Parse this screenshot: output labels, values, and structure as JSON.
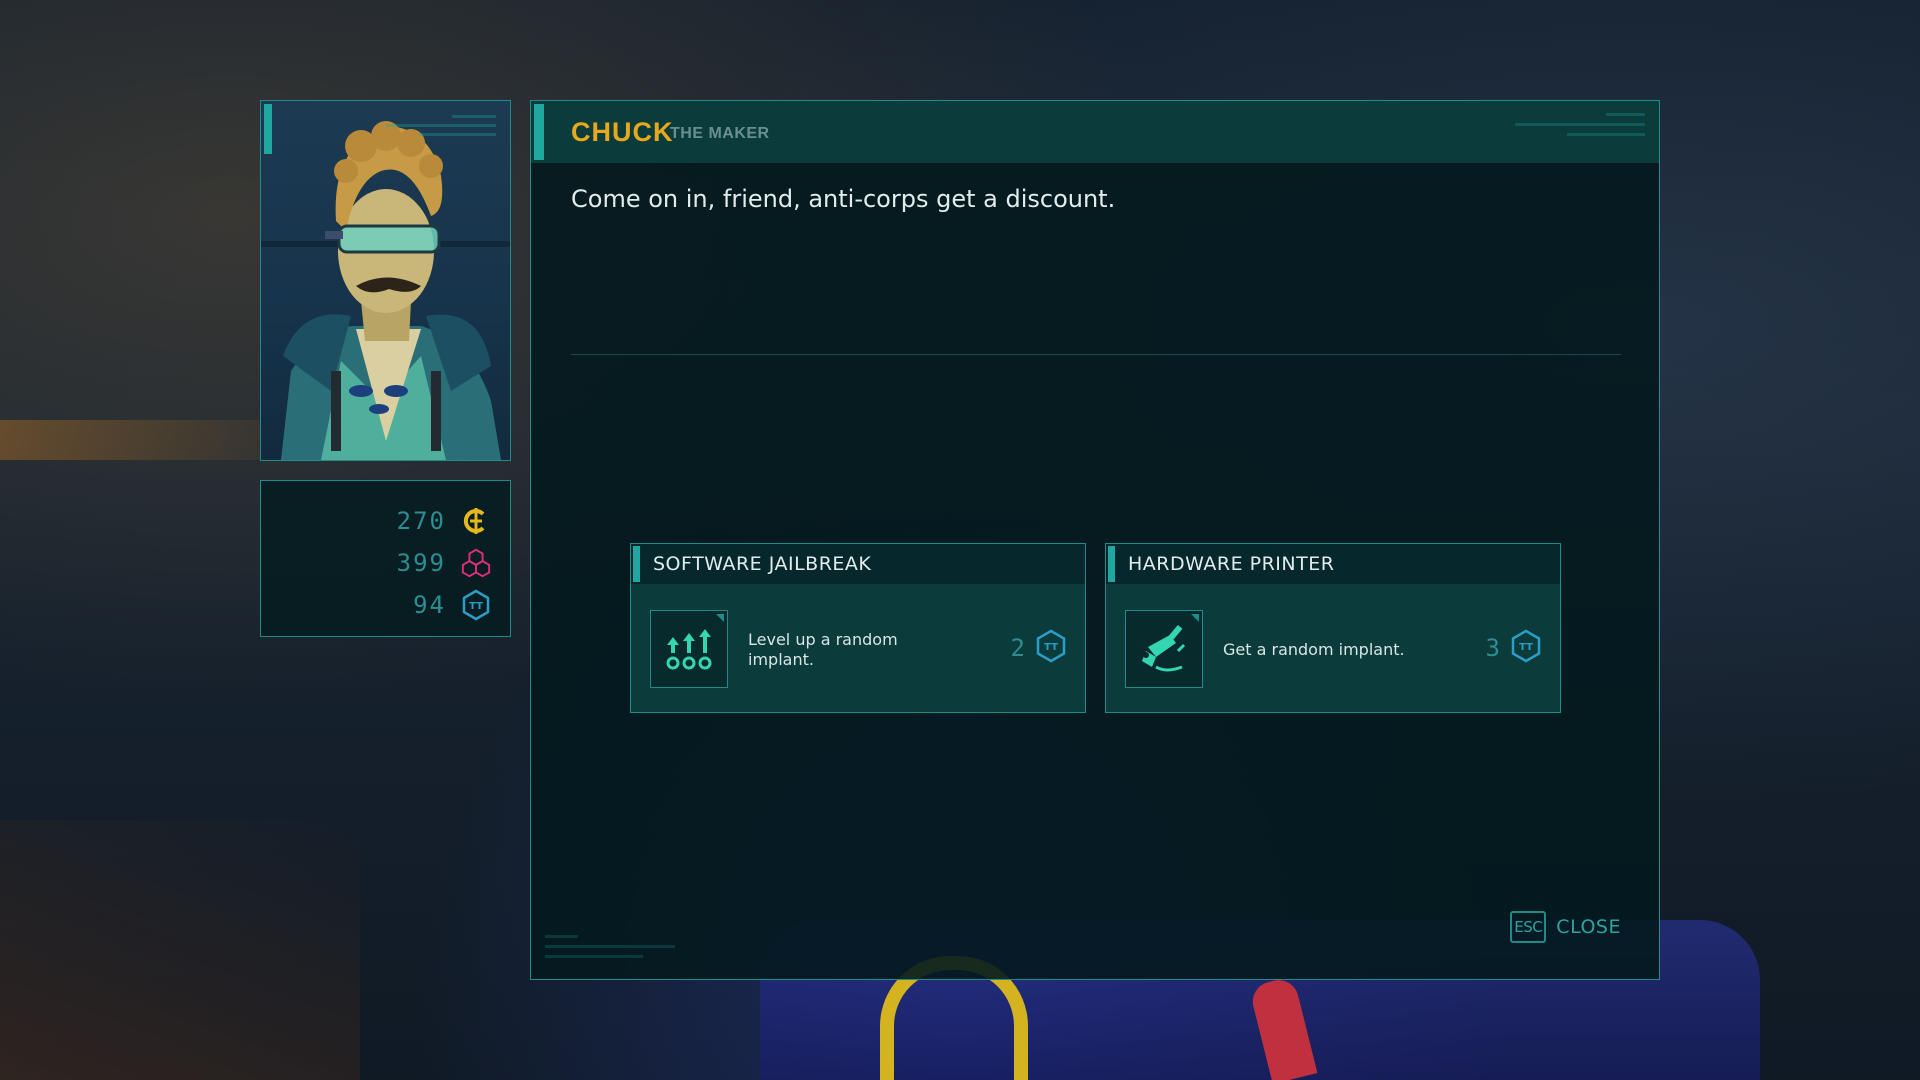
{
  "npc": {
    "name": "CHUCK",
    "title": "THE MAKER",
    "dialogue": "Come on in, friend, anti-corps get a discount."
  },
  "currencies": [
    {
      "value": "270",
      "icon": "credits-icon",
      "color": "#e6b81e"
    },
    {
      "value": "399",
      "icon": "cubes-icon",
      "color": "#e0307a"
    },
    {
      "value": "94",
      "icon": "tt-token-icon",
      "color": "#2a9ec8"
    }
  ],
  "offers": [
    {
      "title": "SOFTWARE JAILBREAK",
      "description": "Level up a random implant.",
      "cost": "2",
      "icon": "level-up-implants-icon",
      "cost_icon": "tt-token-icon"
    },
    {
      "title": "HARDWARE PRINTER",
      "description": "Get a random implant.",
      "cost": "3",
      "icon": "implant-printer-icon",
      "cost_icon": "tt-token-icon"
    }
  ],
  "close": {
    "key": "ESC",
    "label": "CLOSE"
  },
  "colors": {
    "accent_teal": "#1fa7a0",
    "name_gold": "#e6a91e",
    "panel_bg": "#0b3b3b"
  }
}
